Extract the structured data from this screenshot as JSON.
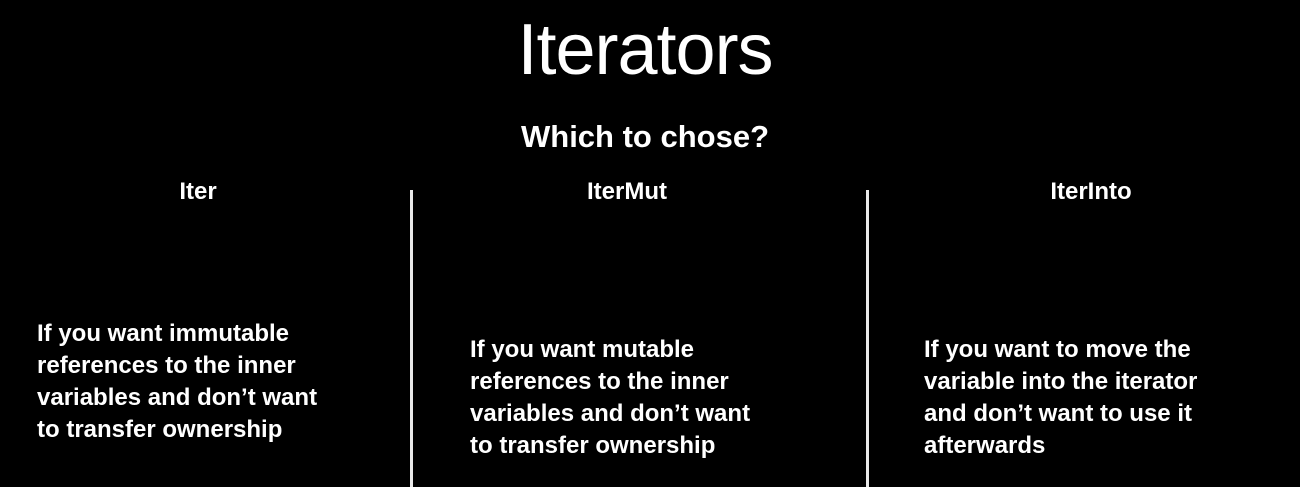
{
  "slide": {
    "title": "Iterators",
    "subtitle": "Which to chose?",
    "columns": [
      {
        "heading": "Iter",
        "body": "If you want immutable\nreferences to the inner\nvariables and don’t want\nto transfer ownership"
      },
      {
        "heading": "IterMut",
        "body": "If you want mutable\nreferences to the inner\nvariables and don’t want\nto transfer ownership"
      },
      {
        "heading": "IterInto",
        "body": "If you want to move the\nvariable into the iterator\nand don’t want to use it\nafterwards"
      }
    ],
    "colors": {
      "background": "#000000",
      "text": "#ffffff",
      "divider": "#e9e9e9"
    }
  }
}
